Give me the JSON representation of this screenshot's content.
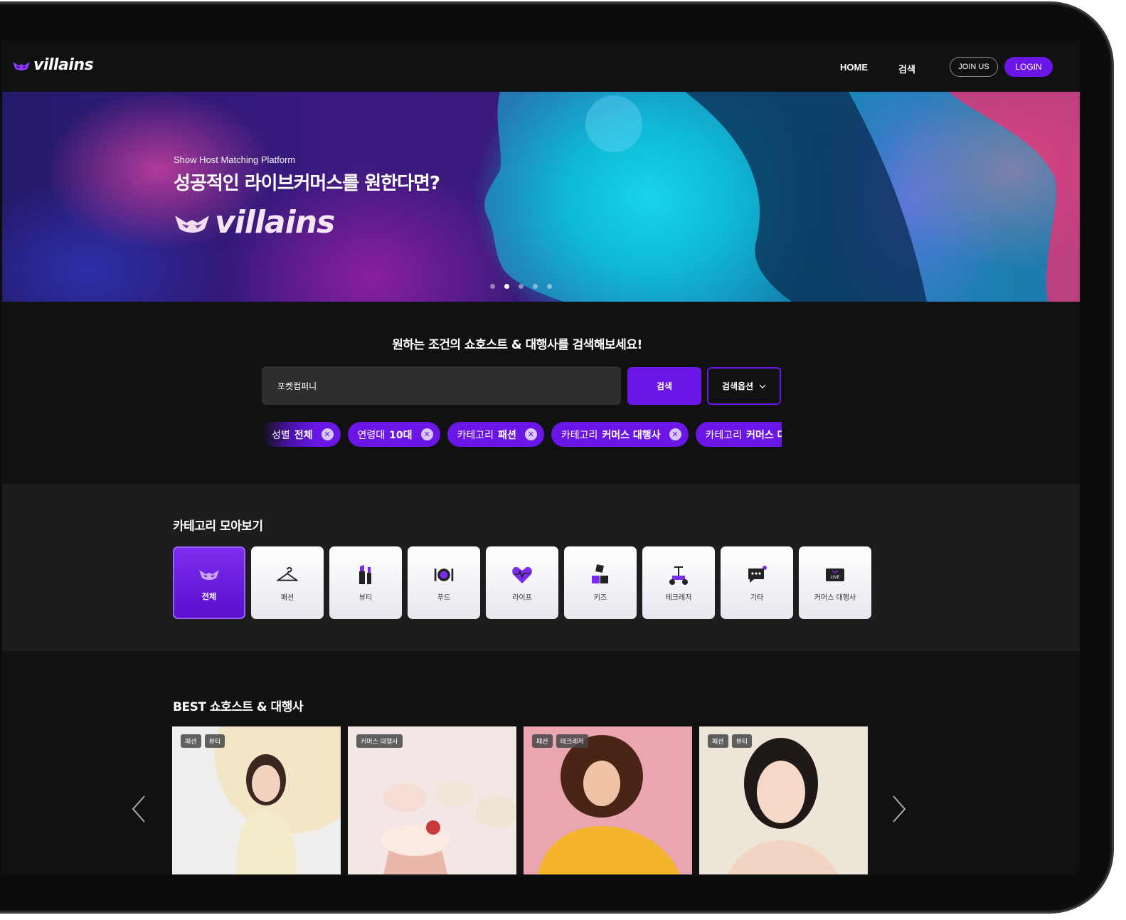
{
  "brand": {
    "name": "villains",
    "accent": "#6a16e6"
  },
  "nav": {
    "home": "HOME",
    "search": "검색",
    "join": "JOIN US",
    "login": "LOGIN"
  },
  "hero": {
    "subtitle": "Show Host Matching Platform",
    "title": "성공적인 라이브커머스를 원한다면?",
    "logo_text": "villains",
    "slides": 5,
    "active_slide": 2
  },
  "search": {
    "heading": "원하는 조건의 쇼호스트 & 대행사를 검색해보세요!",
    "input_value": "포켓컴퍼니",
    "button": "검색",
    "options_button": "검색옵션",
    "chips": [
      {
        "key": "성별",
        "value": "전체"
      },
      {
        "key": "연령대",
        "value": "10대"
      },
      {
        "key": "카테고리",
        "value": "패션"
      },
      {
        "key": "카테고리",
        "value": "커머스 대행사"
      },
      {
        "key": "카테고리",
        "value": "커머스 대"
      }
    ]
  },
  "categories": {
    "heading": "카테고리 모아보기",
    "items": [
      {
        "label": "전체",
        "icon": "mask-icon",
        "active": true
      },
      {
        "label": "패션",
        "icon": "hanger-icon"
      },
      {
        "label": "뷰티",
        "icon": "cosmetics-icon"
      },
      {
        "label": "푸드",
        "icon": "plate-icon"
      },
      {
        "label": "라이프",
        "icon": "heart-pulse-icon"
      },
      {
        "label": "키즈",
        "icon": "blocks-icon"
      },
      {
        "label": "테크레저",
        "icon": "scooter-icon"
      },
      {
        "label": "기타",
        "icon": "chat-icon"
      },
      {
        "label": "커머스 대행사",
        "icon": "live-icon"
      }
    ]
  },
  "best": {
    "heading": "BEST 쇼호스트 & 대행사",
    "cards": [
      {
        "tags": [
          "패션",
          "뷰티"
        ],
        "bg": "#efeeec"
      },
      {
        "tags": [
          "커머스 대행사"
        ],
        "bg": "#f3e6e4"
      },
      {
        "tags": [
          "패션",
          "테크레저"
        ],
        "bg": "#e9a5b0"
      },
      {
        "tags": [
          "패션",
          "뷰티"
        ],
        "bg": "#ece5d8"
      }
    ]
  }
}
